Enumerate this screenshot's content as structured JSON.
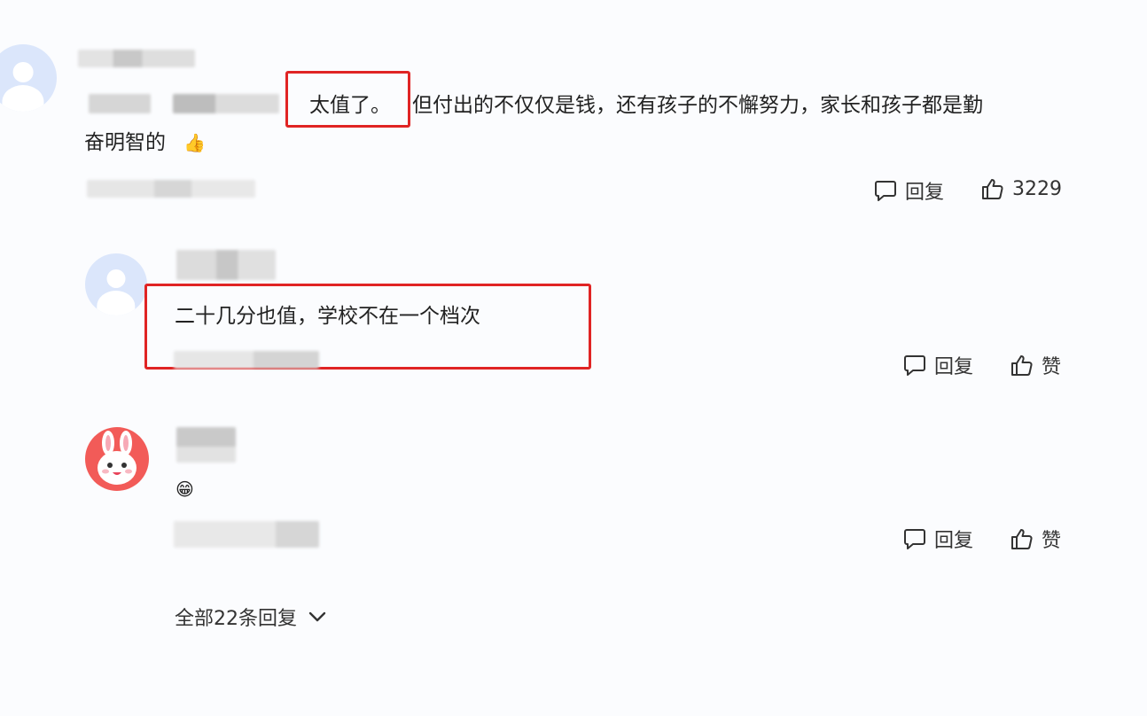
{
  "comments": [
    {
      "text_highlight": "太值了。",
      "text_line1": "但付出的不仅仅是钱，还有孩子的不懈努力，家长和孩子都是勤",
      "text_line2": "奋明智的",
      "emoji": "👍",
      "reply_label": "回复",
      "like_count": "3229"
    },
    {
      "text": "二十几分也值，学校不在一个档次",
      "reply_label": "回复",
      "like_label": "赞"
    },
    {
      "emoji": "😁",
      "reply_label": "回复",
      "like_label": "赞"
    }
  ],
  "footer": {
    "all_replies_label": "全部22条回复"
  },
  "colors": {
    "highlight_box": "#e02424",
    "background": "#fbfcfe"
  }
}
